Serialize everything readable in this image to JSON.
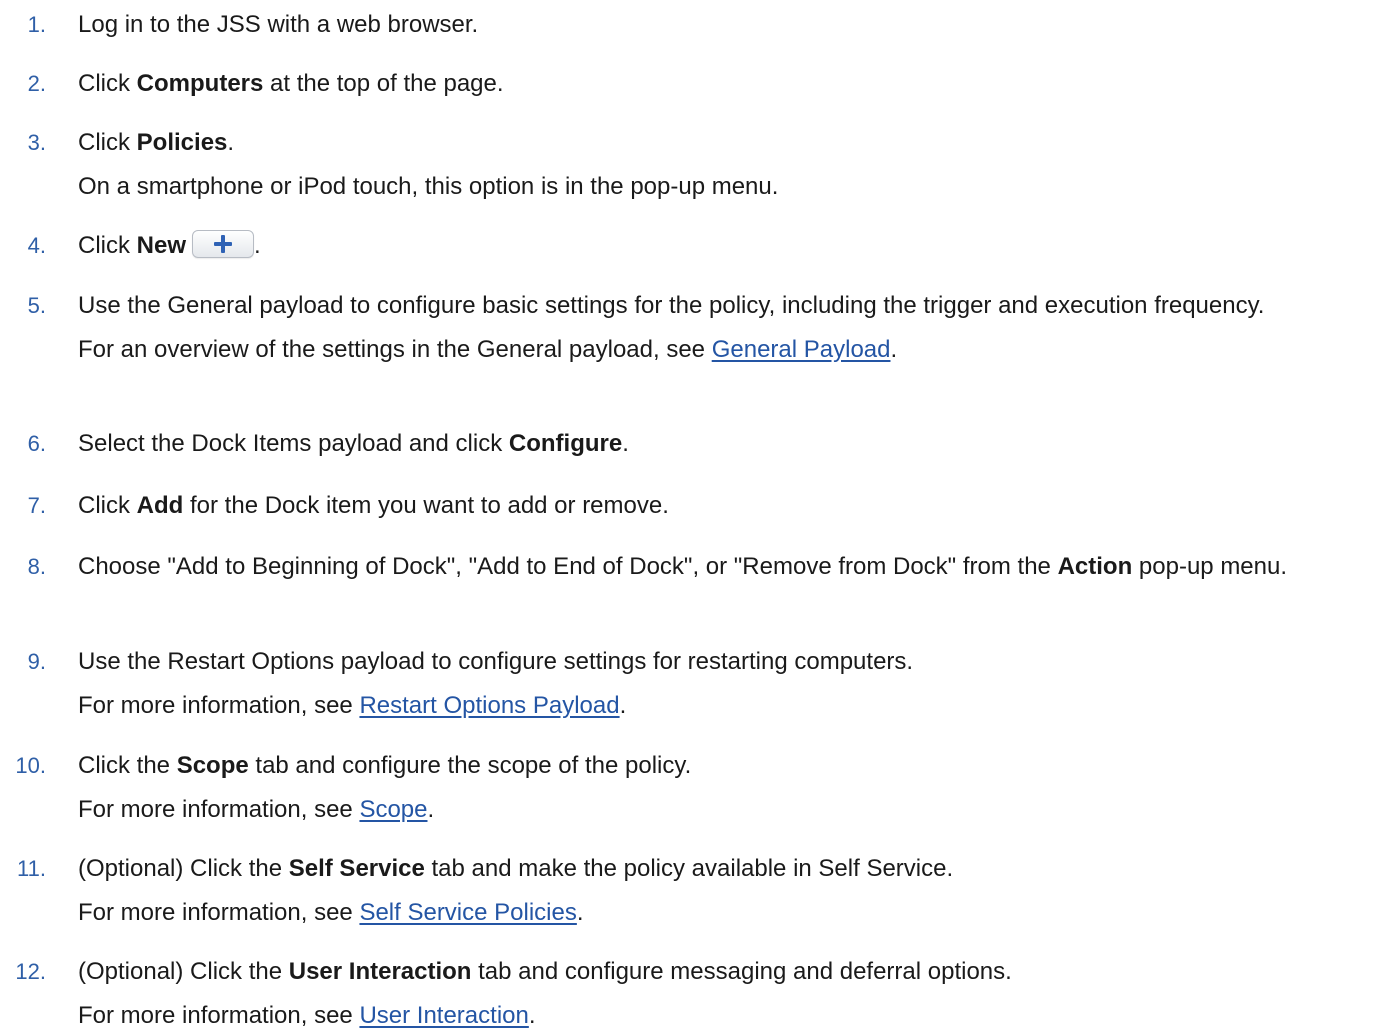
{
  "steps": [
    {
      "num": "1.",
      "pre": "Log in to the JSS with a web browser.",
      "bold": "",
      "post": ""
    },
    {
      "num": "2.",
      "pre": "Click ",
      "bold": "Computers",
      "post": " at the top of the page."
    },
    {
      "num": "3.",
      "pre": "Click ",
      "bold": "Policies",
      "post": ".",
      "note": "On a smartphone or iPod touch, this option is in the pop-up menu."
    },
    {
      "num": "4.",
      "pre": "Click ",
      "bold": "New",
      "post": ".",
      "icon": "plus-icon"
    },
    {
      "num": "5.",
      "pre": "Use the General payload to configure basic settings for the policy, including the trigger and execution frequency.",
      "note_pre": "For an overview of the settings in the General payload, see ",
      "link": "General Payload",
      "note_post": "."
    },
    {
      "num": "6.",
      "pre": "Select the Dock Items payload and click ",
      "bold": "Configure",
      "post": "."
    },
    {
      "num": "7.",
      "pre": "Click ",
      "bold": "Add",
      "post": " for the Dock item you want to add or remove."
    },
    {
      "num": "8.",
      "pre": "Choose \"Add to Beginning of Dock\", \"Add to End of Dock\", or \"Remove from Dock\" from the ",
      "bold": "Action",
      "post": " pop-up menu."
    },
    {
      "num": "9.",
      "pre": "Use the Restart Options payload to configure settings for restarting computers.",
      "note_pre": "For more information, see ",
      "link": " Restart Options Payload",
      "note_post": "."
    },
    {
      "num": "10.",
      "pre": "Click the ",
      "bold": "Scope",
      "post": " tab and configure the scope of the policy.",
      "note_pre": "For more information, see ",
      "link": "Scope",
      "note_post": "."
    },
    {
      "num": "11.",
      "pre": "(Optional) Click the ",
      "bold": "Self Service",
      "post": " tab and make the policy available in Self Service.",
      "note_pre": "For more information, see ",
      "link": "Self Service Policies",
      "note_post": "."
    },
    {
      "num": "12.",
      "pre": "(Optional) Click the ",
      "bold": "User Interaction",
      "post": " tab and configure messaging and deferral options.",
      "note_pre": "For more information, see ",
      "link": "User Interaction",
      "note_post": "."
    }
  ]
}
